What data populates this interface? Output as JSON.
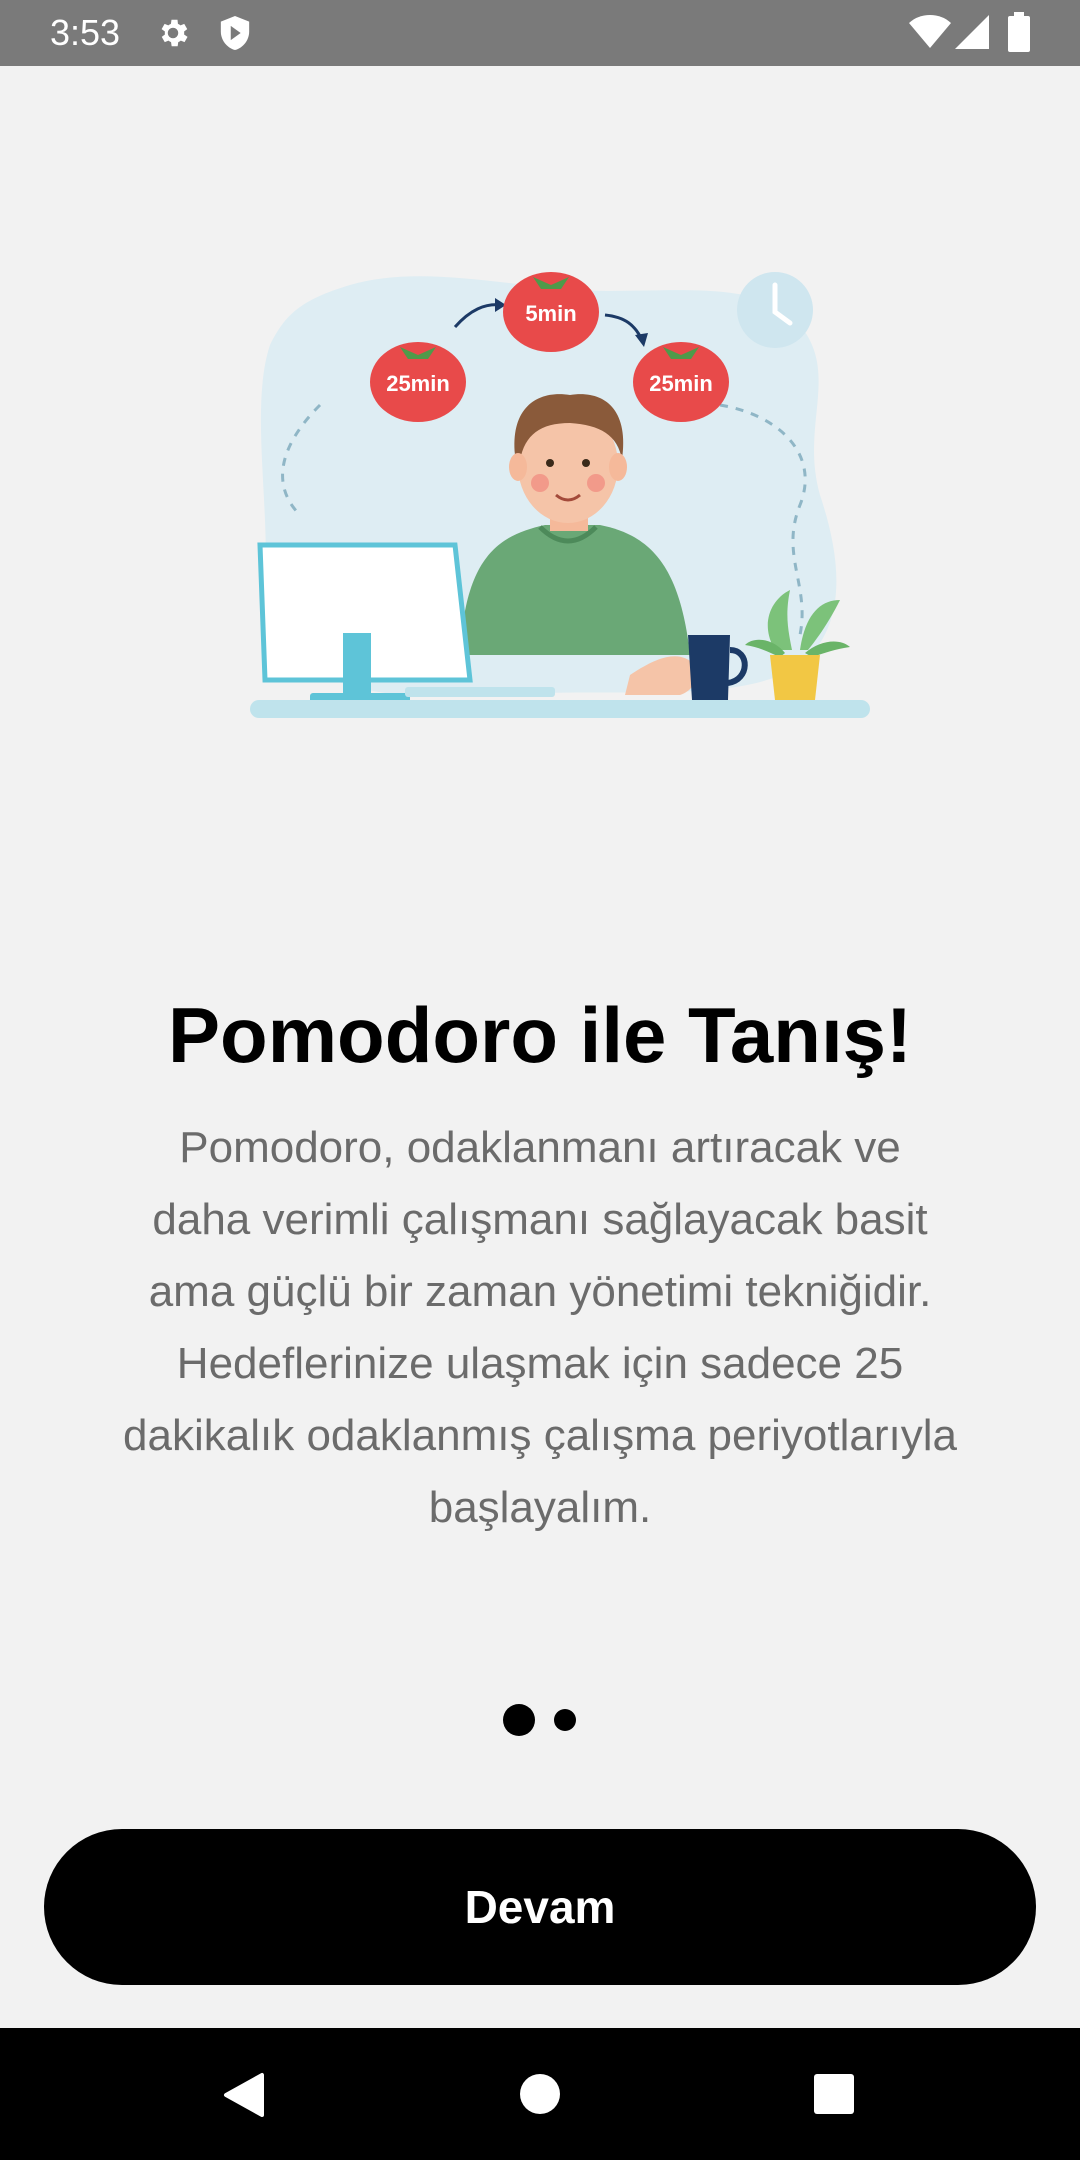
{
  "status_bar": {
    "time": "3:53",
    "left_icons": [
      "gear-icon",
      "shield-icon"
    ],
    "right_icons": [
      "wifi-icon",
      "signal-icon",
      "battery-icon"
    ]
  },
  "illustration": {
    "timers": [
      "25min",
      "5min",
      "25min"
    ],
    "icon": "pomodoro-illustration"
  },
  "onboarding": {
    "title": "Pomodoro ile Tanış!",
    "description": "Pomodoro, odaklanmanı artıracak ve\ndaha verimli çalışmanı sağlayacak basit\nama güçlü bir zaman yönetimi tekniğidir.\nHedeflerinize ulaşmak için sadece 25\ndakikalık odaklanmış çalışma periyotlarıyla\nbaşlayalım.",
    "page_count": 2,
    "current_page": 1,
    "continue_label": "Devam"
  },
  "nav_bar": {
    "buttons": [
      "back-icon",
      "home-icon",
      "recents-icon"
    ]
  },
  "colors": {
    "background": "#f2f2f2",
    "status_bar": "#7a7a7a",
    "button": "#000000",
    "tomato": "#e84a4a",
    "shirt": "#6aa876"
  }
}
